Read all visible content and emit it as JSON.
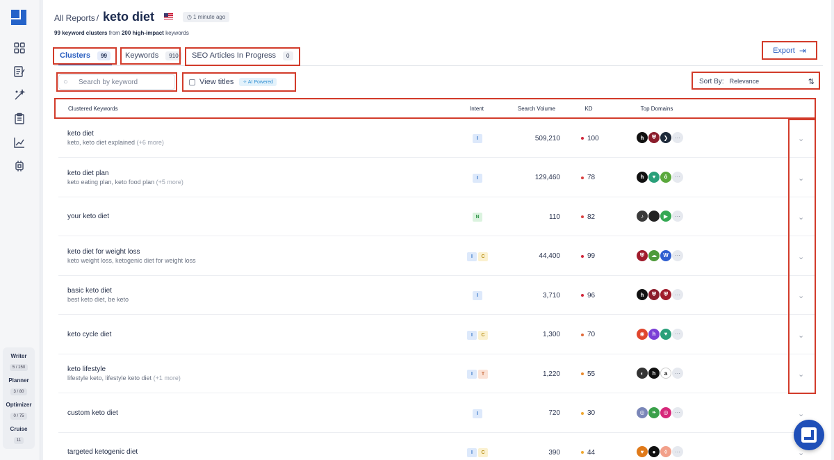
{
  "sidebar": {
    "nav": [
      {
        "name": "dashboard-grid-icon"
      },
      {
        "name": "edit-document-icon"
      },
      {
        "name": "magic-wand-icon"
      },
      {
        "name": "clipboard-icon"
      },
      {
        "name": "chart-line-icon"
      },
      {
        "name": "chip-icon"
      }
    ],
    "usage": [
      {
        "label": "Writer",
        "count": "5 / 150"
      },
      {
        "label": "Planner",
        "count": "3 / 80"
      },
      {
        "label": "Optimizer",
        "count": "0 / 75"
      },
      {
        "label": "Cruise",
        "count": "11"
      }
    ]
  },
  "header": {
    "breadcrumb": "All Reports",
    "separator": "/",
    "title": "keto diet",
    "time": "1 minute ago",
    "subtitle_count_clusters": "99 keyword clusters",
    "subtitle_from": " from ",
    "subtitle_count_keywords": "200 high-impact",
    "subtitle_tail": " keywords"
  },
  "tabs": [
    {
      "label": "Clusters",
      "badge": "99"
    },
    {
      "label": "Keywords",
      "badge": "910"
    },
    {
      "label": "SEO Articles In Progress",
      "badge": "0"
    }
  ],
  "toolbar": {
    "export_label": "Export",
    "search_placeholder": "Search by keyword",
    "view_titles_label": "View titles",
    "ai_badge": "AI Powered",
    "sort_label": "Sort By:",
    "sort_value": "Relevance"
  },
  "table": {
    "headers": {
      "keywords": "Clustered Keywords",
      "intent": "Intent",
      "volume": "Search Volume",
      "kd": "KD",
      "domains": "Top Domains"
    },
    "rows": [
      {
        "title": "keto diet",
        "sub": "keto, keto diet explained",
        "more": "(+6 more)",
        "intent": [
          "I"
        ],
        "volume": "509,210",
        "kd": "100",
        "kd_color": "#d0263a",
        "domains": [
          {
            "bg": "#111111",
            "t": "h"
          },
          {
            "bg": "#8b1d2c",
            "t": "⛨"
          },
          {
            "bg": "#1e2a3a",
            "t": "❯"
          }
        ]
      },
      {
        "title": "keto diet plan",
        "sub": "keto eating plan, keto food plan",
        "more": "(+5 more)",
        "intent": [
          "I"
        ],
        "volume": "129,460",
        "kd": "78",
        "kd_color": "#d94040",
        "domains": [
          {
            "bg": "#111111",
            "t": "h"
          },
          {
            "bg": "#2aa07a",
            "t": "♥"
          },
          {
            "bg": "#5aa83c",
            "t": "ô"
          }
        ]
      },
      {
        "title": "your keto diet",
        "sub": "",
        "more": "",
        "intent": [
          "N"
        ],
        "volume": "110",
        "kd": "82",
        "kd_color": "#d94040",
        "domains": [
          {
            "bg": "#3a3a3a",
            "t": "♪"
          },
          {
            "bg": "#222222",
            "t": ""
          },
          {
            "bg": "#34a853",
            "t": "▶"
          }
        ]
      },
      {
        "title": "keto diet for weight loss",
        "sub": "keto weight loss, ketogenic diet for weight loss",
        "more": "",
        "intent": [
          "I",
          "C"
        ],
        "volume": "44,400",
        "kd": "99",
        "kd_color": "#d0263a",
        "domains": [
          {
            "bg": "#a01c2c",
            "t": "⛨"
          },
          {
            "bg": "#4e9a3a",
            "t": "☁"
          },
          {
            "bg": "#2f5fd0",
            "t": "W"
          }
        ]
      },
      {
        "title": "basic keto diet",
        "sub": "best keto diet, be keto",
        "more": "",
        "intent": [
          "I"
        ],
        "volume": "3,710",
        "kd": "96",
        "kd_color": "#d0263a",
        "domains": [
          {
            "bg": "#111111",
            "t": "h"
          },
          {
            "bg": "#8b1d2c",
            "t": "⛨"
          },
          {
            "bg": "#a01c2c",
            "t": "⛨"
          }
        ]
      },
      {
        "title": "keto cycle diet",
        "sub": "",
        "more": "",
        "intent": [
          "I",
          "C"
        ],
        "volume": "1,300",
        "kd": "70",
        "kd_color": "#e06a3a",
        "domains": [
          {
            "bg": "#e0462e",
            "t": "◉"
          },
          {
            "bg": "#7b3fd6",
            "t": "h"
          },
          {
            "bg": "#2aa07a",
            "t": "♥"
          }
        ]
      },
      {
        "title": "keto lifestyle",
        "sub": "lifestyle keto, lifestyle keto diet",
        "more": "(+1 more)",
        "intent": [
          "I",
          "T"
        ],
        "volume": "1,220",
        "kd": "55",
        "kd_color": "#e8892e",
        "domains": [
          {
            "bg": "#333333",
            "t": "◐"
          },
          {
            "bg": "#111111",
            "t": "h"
          },
          {
            "bg": "#ffffff",
            "t": "a"
          }
        ]
      },
      {
        "title": "custom keto diet",
        "sub": "",
        "more": "",
        "intent": [
          "I"
        ],
        "volume": "720",
        "kd": "30",
        "kd_color": "#f0a830",
        "domains": [
          {
            "bg": "#7a86b8",
            "t": "◎"
          },
          {
            "bg": "#3aa04a",
            "t": "❧"
          },
          {
            "bg": "#d6287a",
            "t": "◎"
          }
        ]
      },
      {
        "title": "targeted ketogenic diet",
        "sub": "",
        "more": "",
        "intent": [
          "I",
          "C"
        ],
        "volume": "390",
        "kd": "44",
        "kd_color": "#f0a830",
        "domains": [
          {
            "bg": "#e07a1a",
            "t": "♥"
          },
          {
            "bg": "#111111",
            "t": "●"
          },
          {
            "bg": "#f2a08a",
            "t": "◊"
          }
        ]
      }
    ]
  }
}
